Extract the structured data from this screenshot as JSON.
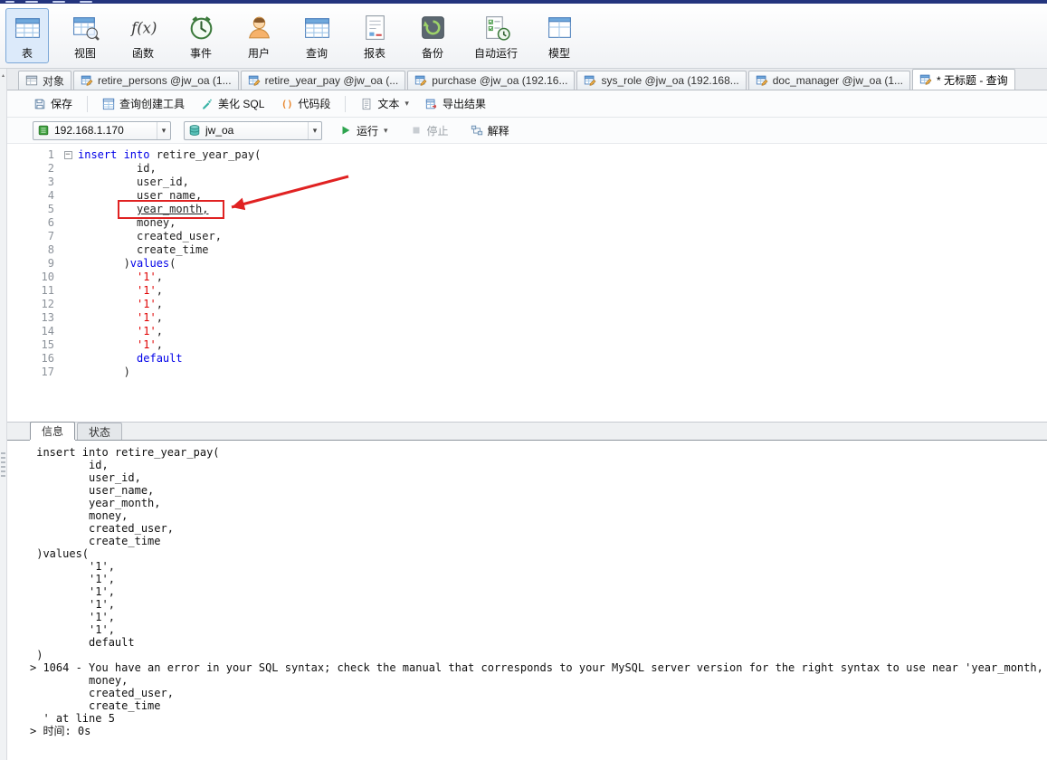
{
  "main_toolbar": {
    "items": [
      {
        "key": "table",
        "label": "表",
        "icon": "table-icon",
        "selected": true
      },
      {
        "key": "view",
        "label": "视图",
        "icon": "view-icon"
      },
      {
        "key": "function",
        "label": "函数",
        "icon": "function-icon"
      },
      {
        "key": "event",
        "label": "事件",
        "icon": "event-icon"
      },
      {
        "key": "user",
        "label": "用户",
        "icon": "user-icon"
      },
      {
        "key": "query",
        "label": "查询",
        "icon": "query-icon"
      },
      {
        "key": "report",
        "label": "报表",
        "icon": "report-icon"
      },
      {
        "key": "backup",
        "label": "备份",
        "icon": "backup-icon"
      },
      {
        "key": "automation",
        "label": "自动运行",
        "icon": "automation-icon"
      },
      {
        "key": "model",
        "label": "模型",
        "icon": "model-icon"
      }
    ]
  },
  "tab_bar": {
    "tabs": [
      {
        "key": "objects",
        "label": "对象",
        "icon": "objects-icon"
      },
      {
        "key": "retire-persons",
        "label": "retire_persons @jw_oa (1...",
        "icon": "table-edit-icon"
      },
      {
        "key": "retire-year-pay",
        "label": "retire_year_pay @jw_oa (...",
        "icon": "table-edit-icon"
      },
      {
        "key": "purchase",
        "label": "purchase @jw_oa (192.16...",
        "icon": "table-edit-icon"
      },
      {
        "key": "sys-role",
        "label": "sys_role @jw_oa (192.168...",
        "icon": "table-edit-icon"
      },
      {
        "key": "doc-manager",
        "label": "doc_manager @jw_oa (1...",
        "icon": "table-edit-icon"
      },
      {
        "key": "untitled-query",
        "label": "* 无标题 - 查询",
        "icon": "query-edit-icon",
        "active": true
      }
    ]
  },
  "query_toolbar": {
    "buttons": [
      {
        "key": "save",
        "label": "保存",
        "icon": "save-icon"
      },
      {
        "key": "query-builder",
        "label": "查询创建工具",
        "icon": "query-builder-icon",
        "sep_before": true
      },
      {
        "key": "beautify-sql",
        "label": "美化 SQL",
        "icon": "beautify-icon"
      },
      {
        "key": "code-snippet",
        "label": "代码段",
        "icon": "snippet-icon"
      },
      {
        "key": "text-view",
        "label": "文本",
        "icon": "text-icon",
        "dropdown": true,
        "sep_before": true
      },
      {
        "key": "export-result",
        "label": "导出结果",
        "icon": "export-icon"
      }
    ]
  },
  "connection_bar": {
    "connection": {
      "value": "192.168.1.170",
      "icon": "connection-icon"
    },
    "database": {
      "value": "jw_oa",
      "icon": "database-icon"
    },
    "run_label": "运行",
    "stop_label": "停止",
    "explain_label": "解释"
  },
  "editor": {
    "lines": [
      {
        "num": "1",
        "fold": true,
        "segs": [
          {
            "t": "kw",
            "v": "insert into"
          },
          {
            "t": "pl",
            "v": " retire_year_pay("
          }
        ]
      },
      {
        "num": "2",
        "segs": [
          {
            "t": "pl",
            "v": "         id,"
          }
        ]
      },
      {
        "num": "3",
        "segs": [
          {
            "t": "pl",
            "v": "         user_id,"
          }
        ]
      },
      {
        "num": "4",
        "segs": [
          {
            "t": "pl",
            "v": "         "
          },
          {
            "t": "pl",
            "v": "user_name,",
            "u": true
          }
        ]
      },
      {
        "num": "5",
        "segs": [
          {
            "t": "pl",
            "v": "         "
          },
          {
            "t": "pl",
            "v": "year_month,",
            "u": true,
            "highlight": true
          }
        ]
      },
      {
        "num": "6",
        "segs": [
          {
            "t": "pl",
            "v": "         money,"
          }
        ]
      },
      {
        "num": "7",
        "segs": [
          {
            "t": "pl",
            "v": "         created_user,"
          }
        ]
      },
      {
        "num": "8",
        "segs": [
          {
            "t": "pl",
            "v": "         create_time"
          }
        ]
      },
      {
        "num": "9",
        "segs": [
          {
            "t": "pl",
            "v": "       )"
          },
          {
            "t": "kw",
            "v": "values"
          },
          {
            "t": "pl",
            "v": "("
          }
        ]
      },
      {
        "num": "10",
        "segs": [
          {
            "t": "pl",
            "v": "         "
          },
          {
            "t": "str",
            "v": "'1'"
          },
          {
            "t": "pl",
            "v": ","
          }
        ]
      },
      {
        "num": "11",
        "segs": [
          {
            "t": "pl",
            "v": "         "
          },
          {
            "t": "str",
            "v": "'1'"
          },
          {
            "t": "pl",
            "v": ","
          }
        ]
      },
      {
        "num": "12",
        "segs": [
          {
            "t": "pl",
            "v": "         "
          },
          {
            "t": "str",
            "v": "'1'"
          },
          {
            "t": "pl",
            "v": ","
          }
        ]
      },
      {
        "num": "13",
        "segs": [
          {
            "t": "pl",
            "v": "         "
          },
          {
            "t": "str",
            "v": "'1'"
          },
          {
            "t": "pl",
            "v": ","
          }
        ]
      },
      {
        "num": "14",
        "segs": [
          {
            "t": "pl",
            "v": "         "
          },
          {
            "t": "str",
            "v": "'1'"
          },
          {
            "t": "pl",
            "v": ","
          }
        ]
      },
      {
        "num": "15",
        "segs": [
          {
            "t": "pl",
            "v": "         "
          },
          {
            "t": "str",
            "v": "'1'"
          },
          {
            "t": "pl",
            "v": ","
          }
        ]
      },
      {
        "num": "16",
        "segs": [
          {
            "t": "pl",
            "v": "         "
          },
          {
            "t": "kw",
            "v": "default"
          }
        ]
      },
      {
        "num": "17",
        "segs": [
          {
            "t": "pl",
            "v": "       )"
          }
        ]
      }
    ]
  },
  "bottom_panel": {
    "tabs": [
      {
        "key": "info",
        "label": "信息",
        "active": true
      },
      {
        "key": "status",
        "label": "状态",
        "active": false
      }
    ]
  },
  "output": {
    "lines": [
      " insert into retire_year_pay(",
      "         id,",
      "         user_id,",
      "         user_name,",
      "         year_month,",
      "         money,",
      "         created_user,",
      "         create_time",
      " )values(",
      "         '1',",
      "         '1',",
      "         '1',",
      "         '1',",
      "         '1',",
      "         '1',",
      "         default",
      " )",
      "> 1064 - You have an error in your SQL syntax; check the manual that corresponds to your MySQL server version for the right syntax to use near 'year_month,",
      "         money,",
      "         created_user,",
      "         create_time",
      "  ' at line 5",
      "> 时间: 0s"
    ]
  },
  "colors": {
    "keyword": "#0000e8",
    "string": "#e00000",
    "annotation": "#e02222",
    "selected_toolbar_bg": "#dceafa"
  }
}
